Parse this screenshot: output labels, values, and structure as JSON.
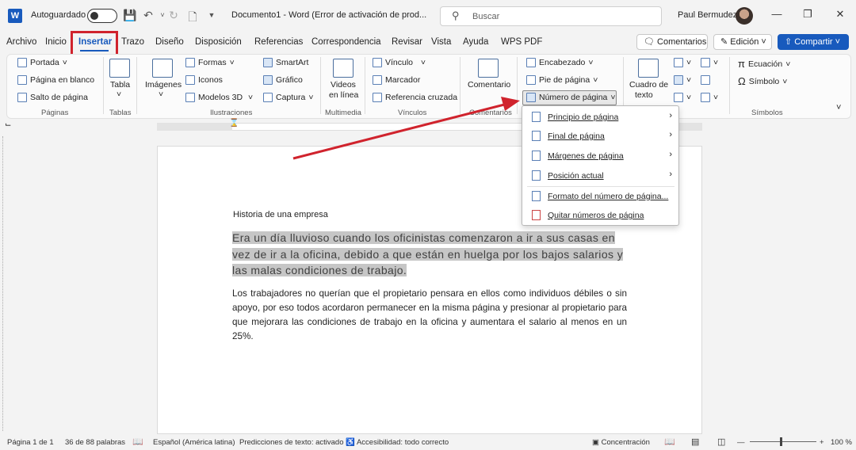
{
  "titlebar": {
    "app_logo": "W",
    "autosave_label": "Autoguardado",
    "doc_title": "Documento1  -  Word (Error de activación de prod...",
    "search_placeholder": "Buscar",
    "user_name": "Paul Bermudez",
    "icons": [
      "save-icon",
      "undo-icon",
      "redo-icon",
      "new-doc-icon",
      "customize-qat-icon",
      "search-icon",
      "minimize-icon",
      "restore-icon",
      "close-icon"
    ]
  },
  "tabs": [
    {
      "label": "Archivo"
    },
    {
      "label": "Inicio"
    },
    {
      "label": "Insertar",
      "active": true
    },
    {
      "label": "Trazo"
    },
    {
      "label": "Diseño"
    },
    {
      "label": "Disposición"
    },
    {
      "label": "Referencias"
    },
    {
      "label": "Correspondencia"
    },
    {
      "label": "Revisar"
    },
    {
      "label": "Vista"
    },
    {
      "label": "Ayuda"
    },
    {
      "label": "WPS PDF"
    }
  ],
  "top_buttons": {
    "comments": "Comentarios",
    "edit": "Edición",
    "share": "Compartir"
  },
  "ribbon": {
    "paginas": {
      "portada": "Portada",
      "pagina_blanco": "Página en blanco",
      "salto": "Salto de página",
      "group": "Páginas"
    },
    "tablas": {
      "tabla": "Tabla",
      "group": "Tablas"
    },
    "ilustraciones": {
      "imagenes": "Imágenes",
      "formas": "Formas",
      "iconos": "Iconos",
      "modelos3d": "Modelos 3D",
      "smartart": "SmartArt",
      "grafico": "Gráfico",
      "captura": "Captura",
      "group": "Ilustraciones"
    },
    "multimedia": {
      "videos1": "Videos",
      "videos2": "en línea",
      "group": "Multimedia"
    },
    "vinculos": {
      "vinculo": "Vínculo",
      "marcador": "Marcador",
      "ref_cruzada": "Referencia cruzada",
      "group": "Vínculos"
    },
    "comentarios": {
      "comentario": "Comentario",
      "group": "Comentarios"
    },
    "encabezado": {
      "encabezado": "Encabezado",
      "pie": "Pie de página",
      "numero": "Número de página"
    },
    "texto": {
      "cuadro1": "Cuadro de",
      "cuadro2": "texto",
      "group": "Texto"
    },
    "simbolos": {
      "ecuacion": "Ecuación",
      "simbolo": "Símbolo",
      "group": "Símbolos"
    }
  },
  "menu": {
    "items": [
      {
        "label": "Principio de página",
        "submenu": true
      },
      {
        "label": "Final de página",
        "submenu": true
      },
      {
        "label": "Márgenes de página",
        "submenu": true
      },
      {
        "label": "Posición actual",
        "submenu": true
      },
      {
        "label": "Formato del número de página...",
        "submenu": false
      },
      {
        "label": "Quitar números de página",
        "submenu": false
      }
    ]
  },
  "document": {
    "heading": "Historia de una empresa",
    "highlighted": "Era un día lluvioso cuando los oficinistas comenzaron a ir a sus casas en vez de ir a la oficina, debido a que están en huelga por los bajos salarios y las malas condiciones de trabajo.",
    "body": "Los trabajadores no querían que el propietario pensara en ellos como individuos débiles o sin apoyo, por eso todos acordaron permanecer en la misma página y presionar al propietario para que mejorara las condiciones de trabajo en la oficina y aumentara el salario al menos en un 25%."
  },
  "statusbar": {
    "page": "Página 1 de 1",
    "words": "36 de 88 palabras",
    "language": "Español (América latina)",
    "predictions": "Predicciones de texto: activado",
    "accessibility": "Accesibilidad: todo correcto",
    "focus": "Concentración",
    "zoom": "100 %"
  },
  "colors": {
    "accent": "#185abd",
    "annotation_red": "#d0232d"
  }
}
